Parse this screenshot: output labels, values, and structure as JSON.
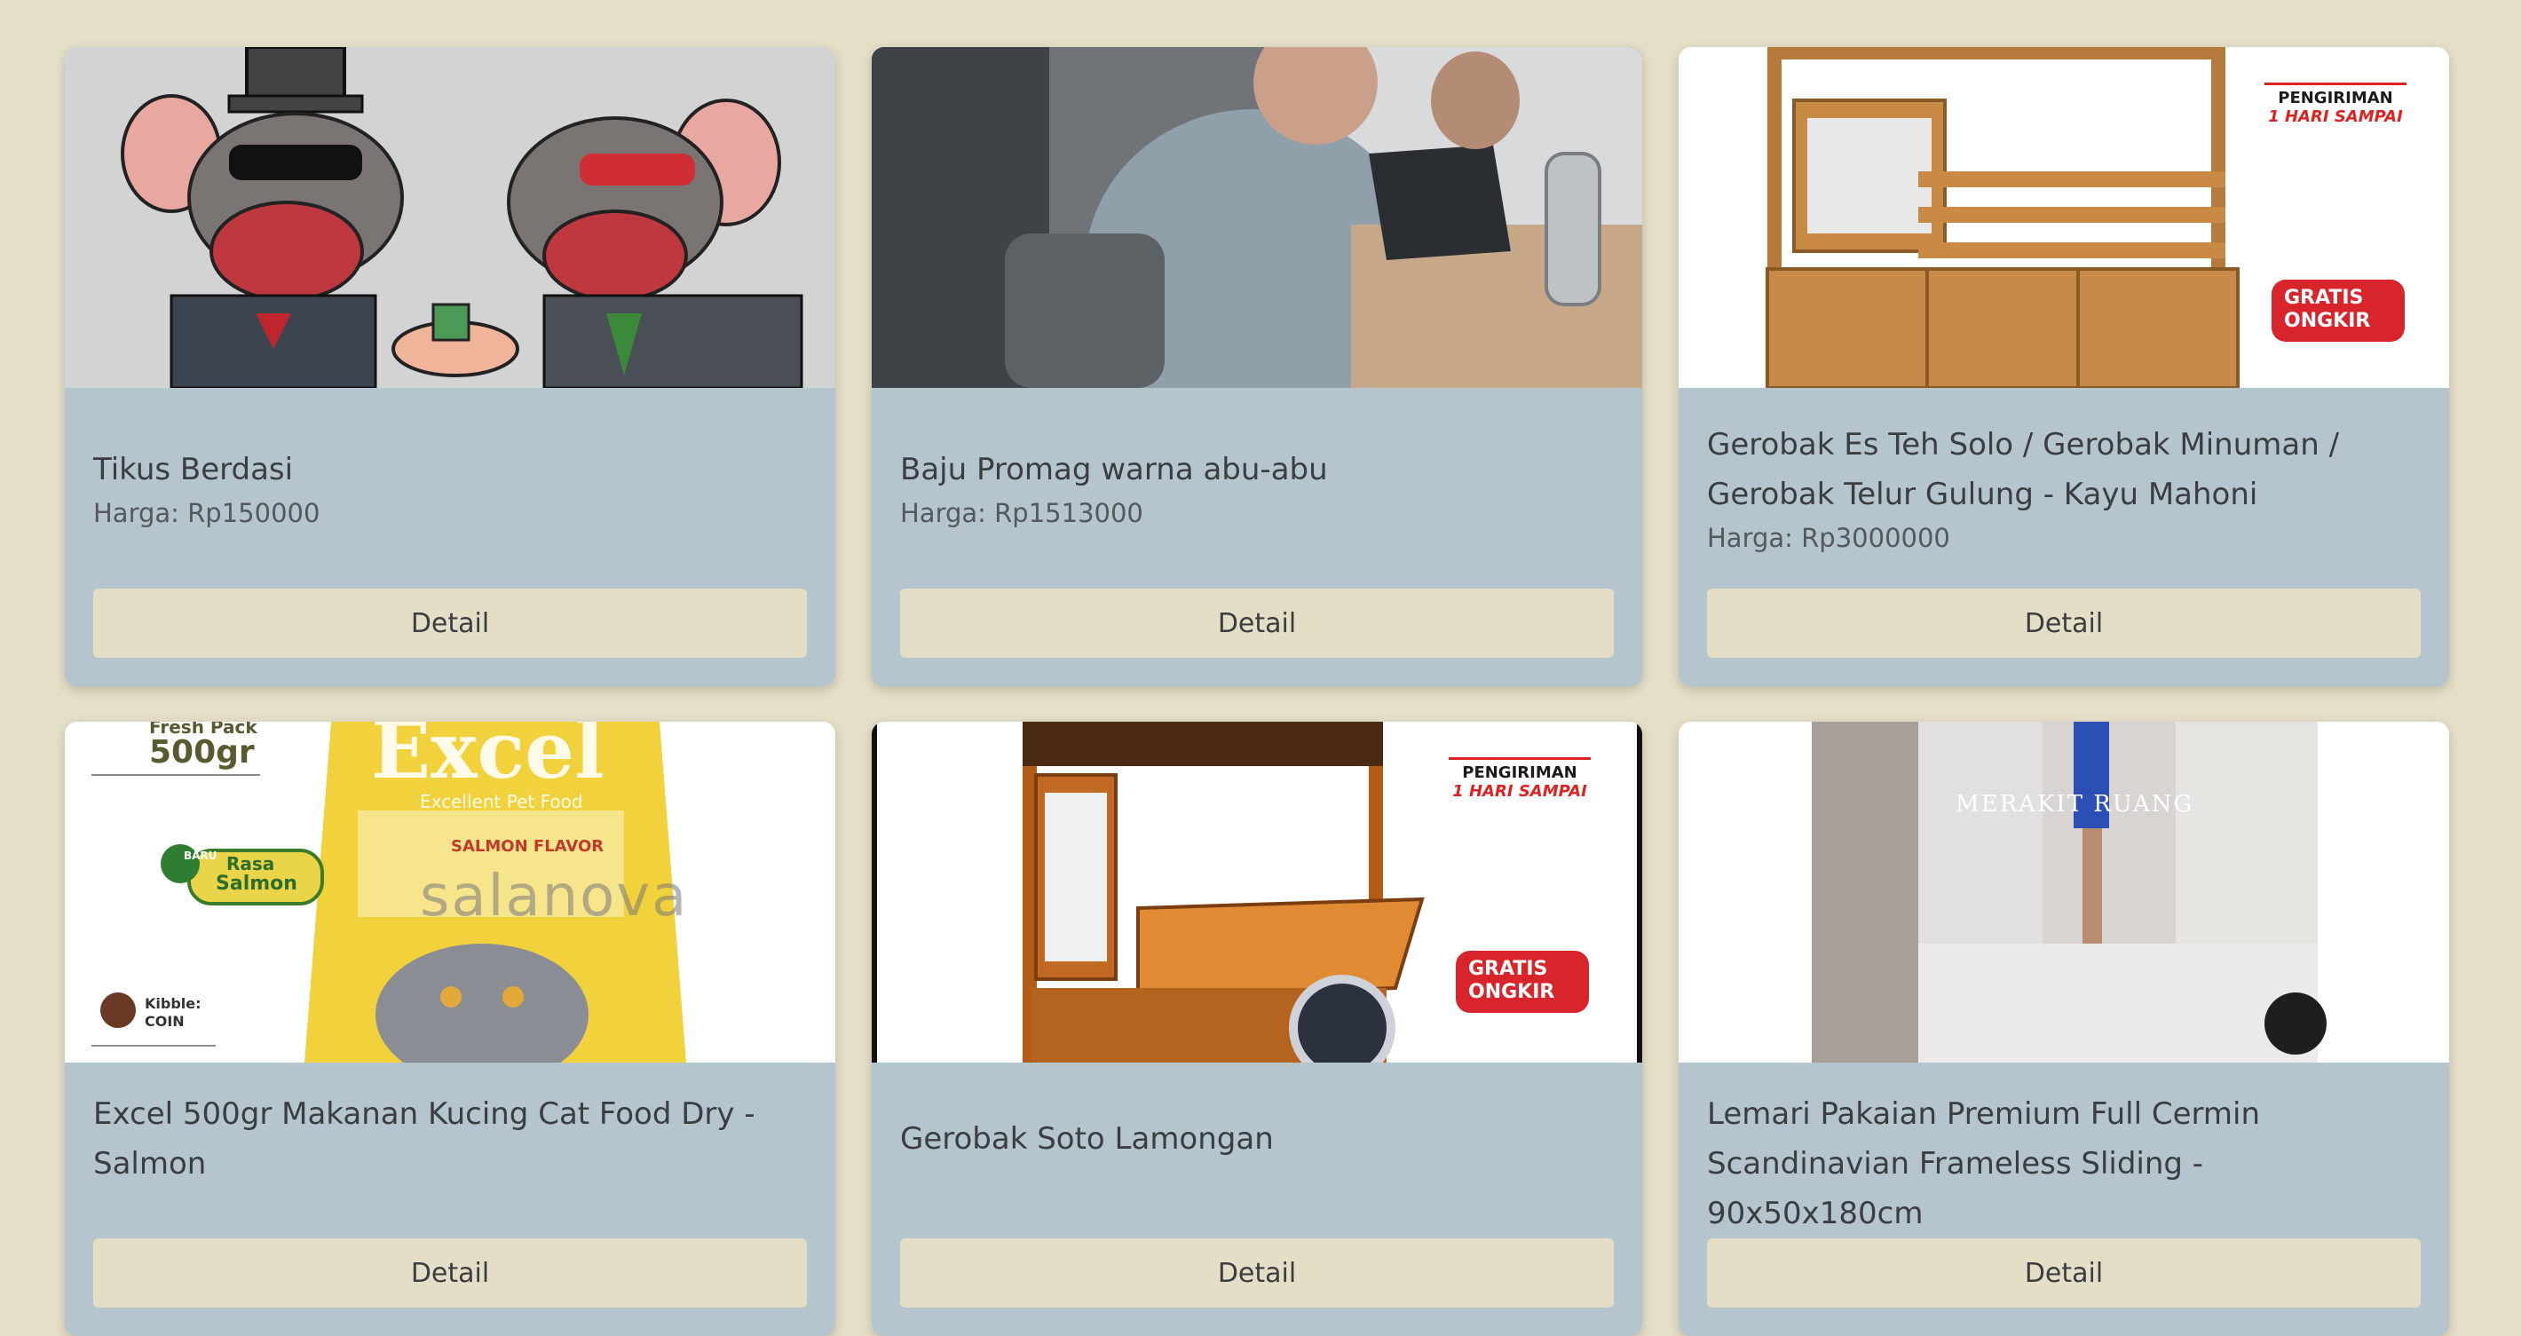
{
  "products": [
    {
      "title": "Tikus Berdasi",
      "price": "Harga: Rp150000",
      "button": "Detail",
      "image": "two-rats-in-suits-cartoon"
    },
    {
      "title": "Baju Promag warna abu-abu",
      "price": "Harga: Rp1513000",
      "button": "Detail",
      "image": "people-working-on-laptops"
    },
    {
      "title": "Gerobak Es Teh Solo / Gerobak Minuman / Gerobak Telur Gulung - Kayu Mahoni",
      "price": "Harga: Rp3000000",
      "button": "Detail",
      "image": "wooden-cart",
      "badges": {
        "ship_line1": "PENGIRIMAN",
        "ship_line2": "1 HARI SAMPAI",
        "free_line1": "GRATIS",
        "free_line2": "ONGKIR"
      }
    },
    {
      "title": "Excel 500gr Makanan Kucing Cat Food Dry - Salmon",
      "price": "",
      "button": "Detail",
      "image": "cat-food-bag",
      "labels": {
        "pack": "Fresh Pack",
        "weight": "500gr",
        "brand": "Excel",
        "tagline": "Excellent Pet Food",
        "flavor": "SALMON FLAVOR",
        "new": "BARU",
        "rasa1": "Rasa",
        "rasa2": "Salmon",
        "kibble1": "Kibble:",
        "kibble2": "COIN",
        "watermark": "salanova"
      }
    },
    {
      "title": "Gerobak Soto Lamongan",
      "price": "",
      "button": "Detail",
      "image": "wooden-food-cart-with-wheel",
      "badges": {
        "ship_line1": "PENGIRIMAN",
        "ship_line2": "1 HARI SAMPAI",
        "free_line1": "GRATIS",
        "free_line2": "ONGKIR"
      }
    },
    {
      "title": "Lemari Pakaian Premium Full Cermin Scandinavian Frameless Sliding - 90x50x180cm",
      "price": "",
      "button": "Detail",
      "image": "mirror-wardrobe",
      "labels": {
        "watermark": "MERAKIT RUANG"
      }
    }
  ],
  "colors": {
    "page_bg": "#e5dfc8",
    "card_bg": "#b4c5cd",
    "button_bg": "#e4dec6",
    "badge_red": "#d8252b"
  }
}
